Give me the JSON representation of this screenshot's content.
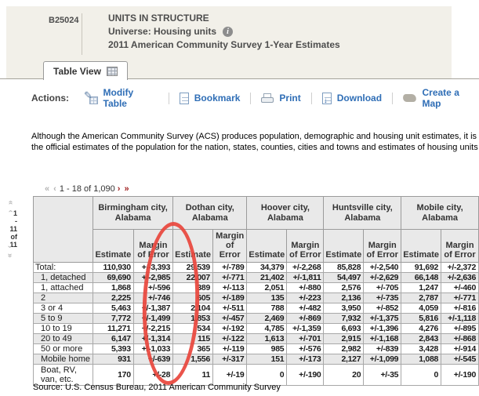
{
  "header": {
    "table_id": "B25024",
    "title": "UNITS IN STRUCTURE",
    "universe": "Universe: Housing units",
    "survey": "2011 American Community Survey 1-Year Estimates"
  },
  "tab": {
    "label": "Table View"
  },
  "actions": {
    "label": "Actions:",
    "items": [
      {
        "label": "Modify Table",
        "icon": "modify-table-icon"
      },
      {
        "label": "Bookmark",
        "icon": "bookmark-icon"
      },
      {
        "label": "Print",
        "icon": "print-icon"
      },
      {
        "label": "Download",
        "icon": "download-icon"
      },
      {
        "label": "Create a Map",
        "icon": "create-map-icon"
      }
    ]
  },
  "note": {
    "line1": "Although the American Community Survey (ACS) produces population, demographic and housing unit estimates, it is the Cen",
    "line2": "the official estimates of the population for the nation, states, counties, cities and towns and estimates of housing units for sta"
  },
  "pagination": {
    "columns": {
      "prev": "« ‹",
      "text": "1 - 18 of 1,090",
      "next": "› »"
    },
    "rows": {
      "from": "1",
      "dash": "-",
      "to": "11",
      "of": "of",
      "total": "11"
    }
  },
  "table": {
    "column_groups": [
      "Birmingham city, Alabama",
      "Dothan city, Alabama",
      "Hoover city, Alabama",
      "Huntsville city, Alabama",
      "Mobile city, Alabama"
    ],
    "sub_headers": {
      "estimate": "Estimate",
      "moe": "Margin of Error"
    },
    "rows": [
      {
        "label": "Total:",
        "values": [
          "110,930",
          "+/-3,393",
          "29,539",
          "+/-789",
          "34,379",
          "+/-2,268",
          "85,828",
          "+/-2,540",
          "91,692",
          "+/-2,372"
        ]
      },
      {
        "label": "1, detached",
        "values": [
          "69,690",
          "+/-2,985",
          "22,007",
          "+/-771",
          "21,402",
          "+/-1,811",
          "54,497",
          "+/-2,629",
          "66,148",
          "+/-2,636"
        ]
      },
      {
        "label": "1, attached",
        "values": [
          "1,868",
          "+/-596",
          "389",
          "+/-113",
          "2,051",
          "+/-880",
          "2,576",
          "+/-705",
          "1,247",
          "+/-460"
        ]
      },
      {
        "label": "2",
        "values": [
          "2,225",
          "+/-746",
          "605",
          "+/-189",
          "135",
          "+/-223",
          "2,136",
          "+/-735",
          "2,787",
          "+/-771"
        ]
      },
      {
        "label": "3 or 4",
        "values": [
          "5,463",
          "+/-1,387",
          "2,104",
          "+/-511",
          "788",
          "+/-482",
          "3,950",
          "+/-852",
          "4,059",
          "+/-816"
        ]
      },
      {
        "label": "5 to 9",
        "values": [
          "7,772",
          "+/-1,499",
          "1,853",
          "+/-457",
          "2,469",
          "+/-869",
          "7,932",
          "+/-1,375",
          "5,816",
          "+/-1,118"
        ]
      },
      {
        "label": "10 to 19",
        "values": [
          "11,271",
          "+/-2,215",
          "534",
          "+/-192",
          "4,785",
          "+/-1,359",
          "6,693",
          "+/-1,396",
          "4,276",
          "+/-895"
        ]
      },
      {
        "label": "20 to 49",
        "values": [
          "6,147",
          "+/-1,314",
          "115",
          "+/-122",
          "1,613",
          "+/-701",
          "2,915",
          "+/-1,168",
          "2,843",
          "+/-868"
        ]
      },
      {
        "label": "50 or more",
        "values": [
          "5,393",
          "+/-1,033",
          "365",
          "+/-119",
          "985",
          "+/-576",
          "2,982",
          "+/-839",
          "3,428",
          "+/-914"
        ]
      },
      {
        "label": "Mobile home",
        "values": [
          "931",
          "+/-639",
          "1,556",
          "+/-317",
          "151",
          "+/-173",
          "2,127",
          "+/-1,099",
          "1,088",
          "+/-545"
        ]
      },
      {
        "label": "Boat, RV, van, etc.",
        "values": [
          "170",
          "+/-28",
          "11",
          "+/-19",
          "0",
          "+/-190",
          "20",
          "+/-35",
          "0",
          "+/-190"
        ]
      }
    ]
  },
  "source": "Source: U.S. Census Bureau, 2011 American Community Survey",
  "annotation": {
    "shape": "ellipse",
    "color": "#e8453c",
    "target": "Birmingham city Margin of Error column"
  },
  "colors": {
    "header_bg": "#f2f0e9",
    "link_blue": "#2f6eb6",
    "table_header_bg": "#e9e9e9",
    "zebra_gray": "#e8e8e8",
    "pager_next_red": "#9f1d1d",
    "annotation_red": "#e8453c"
  }
}
